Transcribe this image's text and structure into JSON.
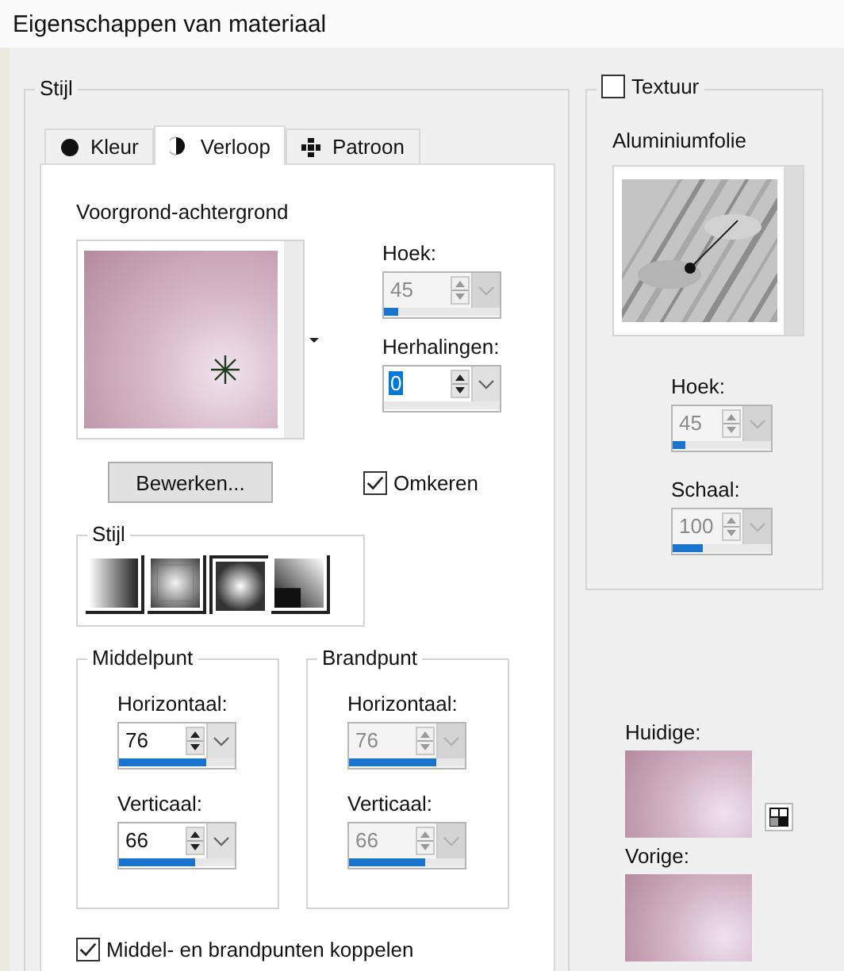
{
  "window": {
    "title": "Eigenschappen van materiaal"
  },
  "style_group": {
    "label": "Stijl",
    "tabs": [
      {
        "kind": "color",
        "label": "Kleur",
        "selected": false
      },
      {
        "kind": "gradient",
        "label": "Verloop",
        "selected": true
      },
      {
        "kind": "pattern",
        "label": "Patroon",
        "selected": false
      }
    ],
    "gradient_name": "Voorgrond-achtergrond",
    "angle": {
      "label": "Hoek:",
      "value": "45",
      "level": 0.125,
      "disabled": true
    },
    "repeats": {
      "label": "Herhalingen:",
      "value": "0",
      "level": 0,
      "disabled": false,
      "highlighted": true
    },
    "edit_button": "Bewerken...",
    "invert": {
      "label": "Omkeren",
      "checked": true
    },
    "style": {
      "label": "Stijl",
      "options": [
        {
          "kind": "linear",
          "selected": false
        },
        {
          "kind": "rectangular",
          "selected": false
        },
        {
          "kind": "radial",
          "selected": true
        },
        {
          "kind": "corner",
          "selected": false
        }
      ]
    },
    "center": {
      "label": "Middelpunt",
      "horizontal": {
        "label": "Horizontaal:",
        "value": "76",
        "level": 0.76,
        "disabled": false
      },
      "vertical": {
        "label": "Verticaal:",
        "value": "66",
        "level": 0.66,
        "disabled": false
      }
    },
    "focus": {
      "label": "Brandpunt",
      "horizontal": {
        "label": "Horizontaal:",
        "value": "76",
        "level": 0.76,
        "disabled": true
      },
      "vertical": {
        "label": "Verticaal:",
        "value": "66",
        "level": 0.66,
        "disabled": true
      }
    },
    "link": {
      "label": "Middel- en brandpunten koppelen",
      "checked": true
    }
  },
  "texture": {
    "label": "Textuur",
    "checked": false,
    "name": "Aluminiumfolie",
    "angle": {
      "label": "Hoek:",
      "value": "45",
      "level": 0.125,
      "disabled": true
    },
    "scale": {
      "label": "Schaal:",
      "value": "100",
      "level": 0.3,
      "disabled": true
    }
  },
  "current": {
    "label": "Huidige:"
  },
  "previous": {
    "label": "Vorige:"
  }
}
